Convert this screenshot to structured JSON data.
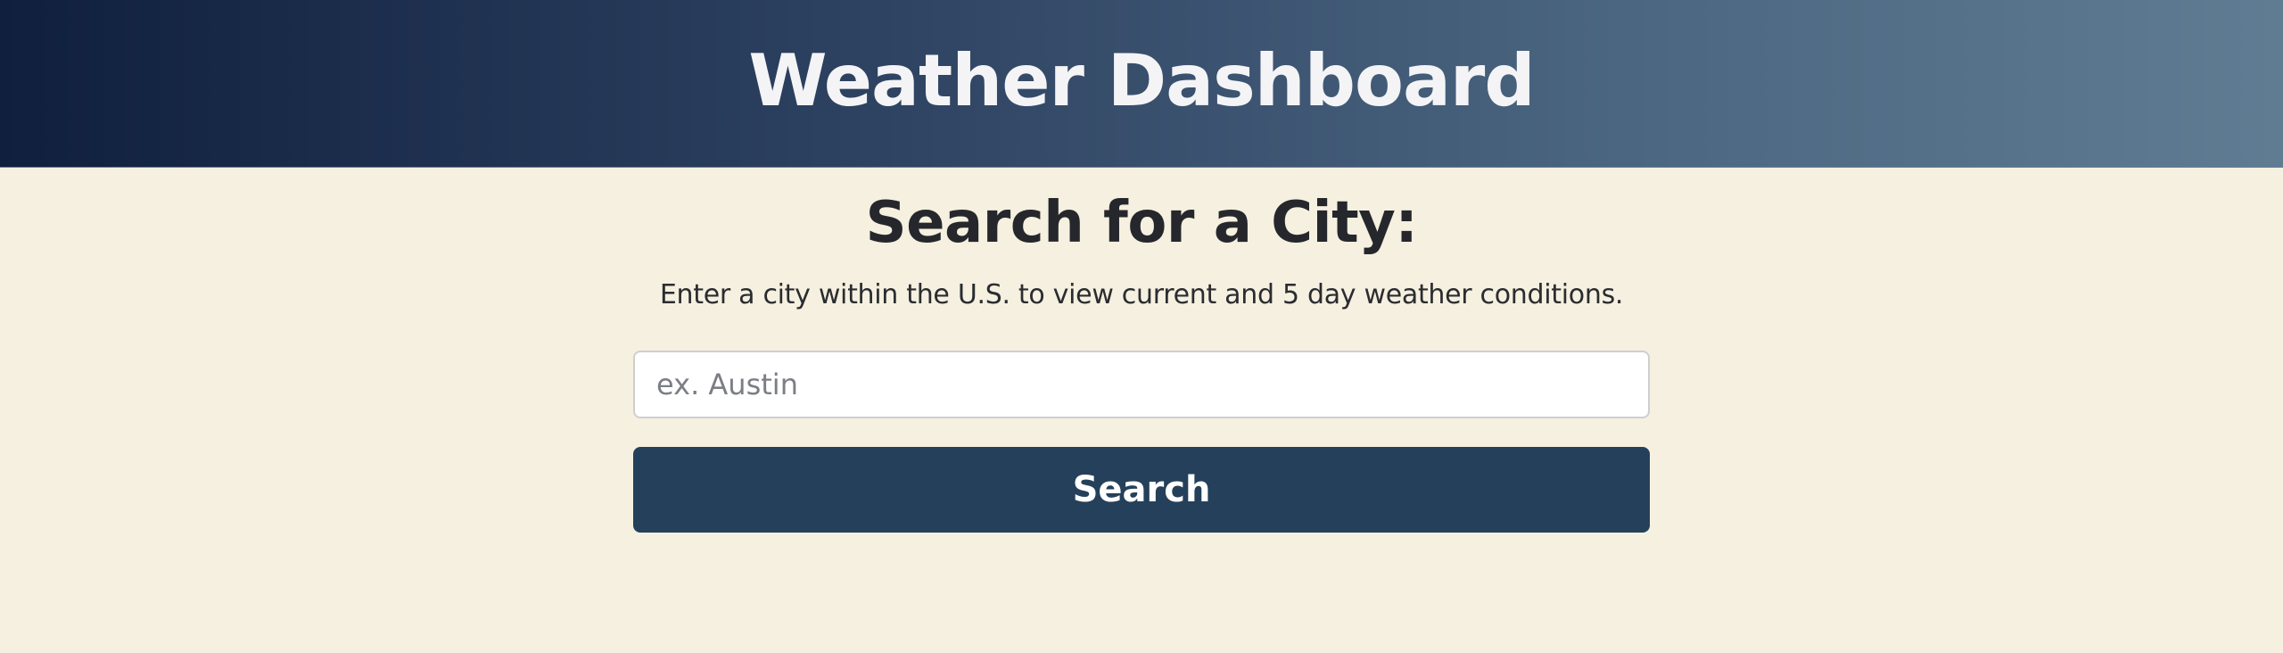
{
  "header": {
    "title": "Weather Dashboard"
  },
  "search": {
    "heading": "Search for a City:",
    "subtext": "Enter a city within the U.S. to view current and 5 day weather conditions.",
    "input_value": "",
    "input_placeholder": "ex. Austin",
    "button_label": "Search"
  },
  "colors": {
    "page_background": "#f5f0df",
    "header_gradient_start": "#0f1f3d",
    "header_gradient_end": "#5f7c93",
    "button_background": "#25405a",
    "header_text": "#f4f4f6",
    "body_text": "#25272c"
  }
}
